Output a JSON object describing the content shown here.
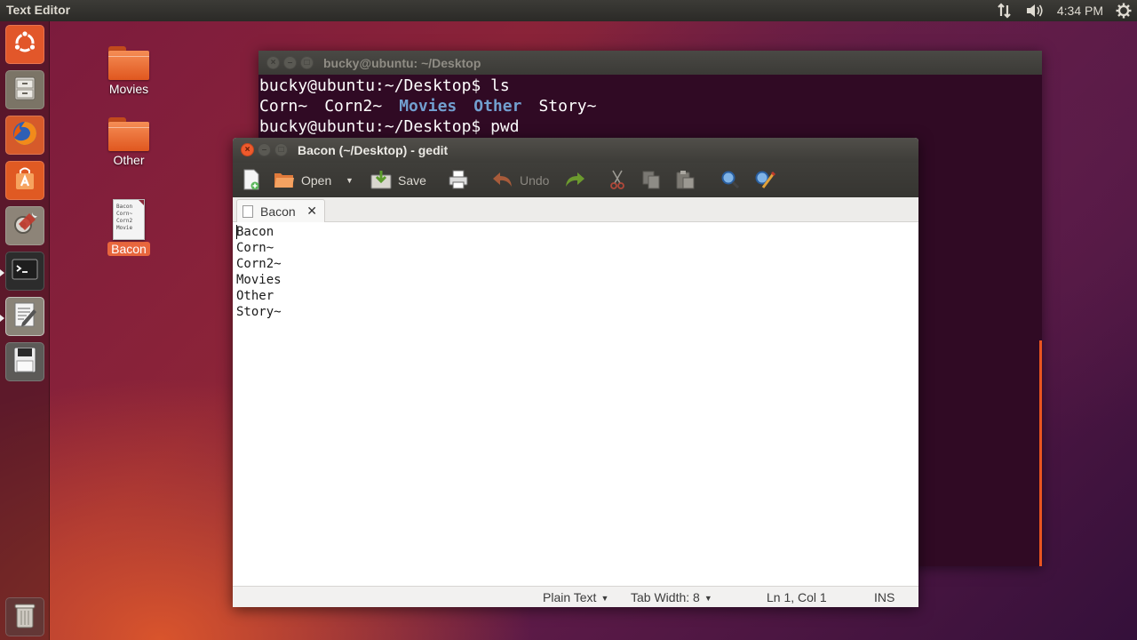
{
  "top_panel": {
    "app_name": "Text Editor",
    "clock": "4:34 PM",
    "icons": [
      "network-icon",
      "volume-icon",
      "settings-gear-icon"
    ]
  },
  "launcher": {
    "items": [
      {
        "name": "dash-home",
        "icon": "ubuntu-logo-icon"
      },
      {
        "name": "files",
        "icon": "file-cabinet-icon"
      },
      {
        "name": "firefox",
        "icon": "firefox-icon"
      },
      {
        "name": "software-center",
        "icon": "shopping-bag-icon"
      },
      {
        "name": "system-settings",
        "icon": "wrench-gear-icon"
      },
      {
        "name": "terminal",
        "icon": "terminal-icon"
      },
      {
        "name": "text-editor",
        "icon": "text-editor-icon"
      },
      {
        "name": "save-device",
        "icon": "floppy-icon"
      },
      {
        "name": "trash",
        "icon": "trash-icon"
      }
    ]
  },
  "desktop": {
    "icons": [
      {
        "label": "Movies",
        "type": "folder"
      },
      {
        "label": "Other",
        "type": "folder"
      },
      {
        "label": "Bacon",
        "type": "text-file",
        "thumb_lines": [
          "Bacon",
          "Corn~",
          "Corn2",
          "Movie"
        ]
      }
    ]
  },
  "terminal": {
    "title": "bucky@ubuntu: ~/Desktop",
    "line1": "bucky@ubuntu:~/Desktop$ ls",
    "ls_output": [
      {
        "name": "Corn~",
        "is_dir": false
      },
      {
        "name": "Corn2~",
        "is_dir": false
      },
      {
        "name": "Movies",
        "is_dir": true
      },
      {
        "name": "Other",
        "is_dir": true
      },
      {
        "name": "Story~",
        "is_dir": false
      }
    ],
    "line3": "bucky@ubuntu:~/Desktop$ pwd",
    "colors": {
      "background": "#300a24",
      "directory": "#729fcf"
    }
  },
  "gedit": {
    "title": "Bacon (~/Desktop) - gedit",
    "toolbar": {
      "open_label": "Open",
      "save_label": "Save",
      "undo_label": "Undo"
    },
    "tab_label": "Bacon",
    "lines": [
      "Bacon",
      "Corn~",
      "Corn2~",
      "Movies",
      "Other",
      "Story~"
    ],
    "status": {
      "language": "Plain Text",
      "tab_width": "Tab Width: 8",
      "position": "Ln 1, Col 1",
      "mode": "INS"
    }
  },
  "colors": {
    "accent": "#e95420",
    "selection": "#e8663d"
  }
}
